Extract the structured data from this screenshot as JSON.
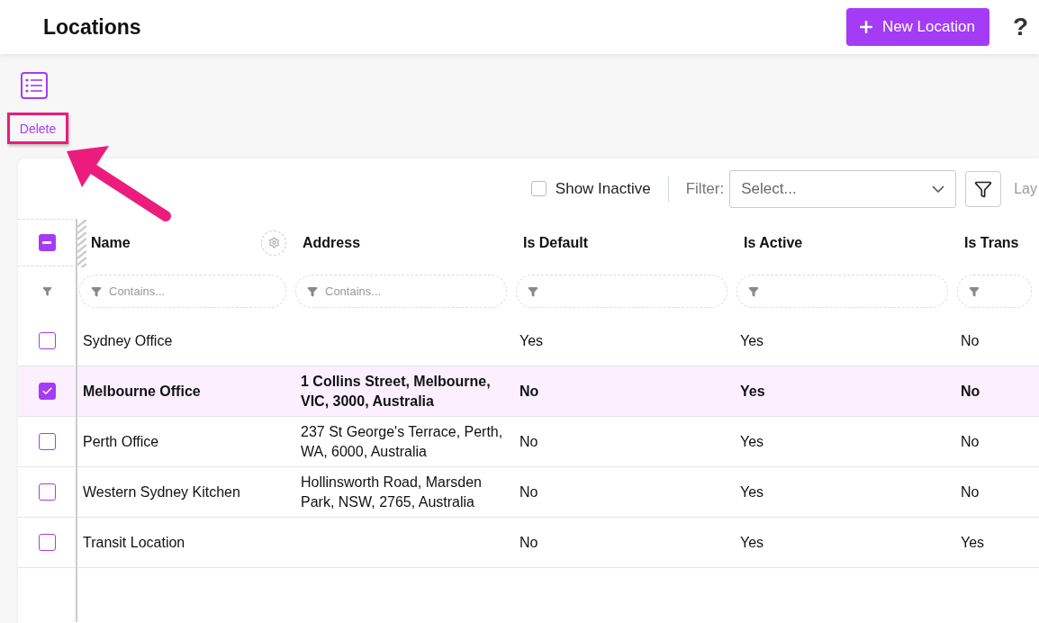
{
  "header": {
    "title": "Locations",
    "new_button": "New Location",
    "help": "?"
  },
  "toolbar": {
    "delete_button": "Delete"
  },
  "filter_bar": {
    "show_inactive": {
      "label": "Show Inactive",
      "checked": false
    },
    "filter_label": "Filter:",
    "select_placeholder": "Select...",
    "layout_label": "Lay"
  },
  "table": {
    "select_all": {
      "indeterminate": true
    },
    "columns": [
      {
        "label": "Name",
        "filter_placeholder": "Contains...",
        "settings": true
      },
      {
        "label": "Address",
        "filter_placeholder": "Contains...",
        "settings": false
      },
      {
        "label": "Is Default",
        "settings": false
      },
      {
        "label": "Is Active",
        "settings": false
      },
      {
        "label": "Is Trans",
        "settings": false
      }
    ],
    "rows": [
      {
        "selected": false,
        "cells": [
          "Sydney Office",
          "",
          "Yes",
          "Yes",
          "No"
        ]
      },
      {
        "selected": true,
        "cells": [
          "Melbourne Office",
          "1 Collins Street, Melbourne, VIC, 3000, Australia",
          "No",
          "Yes",
          "No"
        ]
      },
      {
        "selected": false,
        "cells": [
          "Perth Office",
          "237 St George's Terrace, Perth, WA, 6000, Australia",
          "No",
          "Yes",
          "No"
        ]
      },
      {
        "selected": false,
        "cells": [
          "Western Sydney Kitchen",
          "Hollinsworth Road, Marsden Park, NSW, 2765, Australia",
          "No",
          "Yes",
          "No"
        ]
      },
      {
        "selected": false,
        "cells": [
          "Transit Location",
          "",
          "No",
          "Yes",
          "Yes"
        ]
      }
    ]
  }
}
